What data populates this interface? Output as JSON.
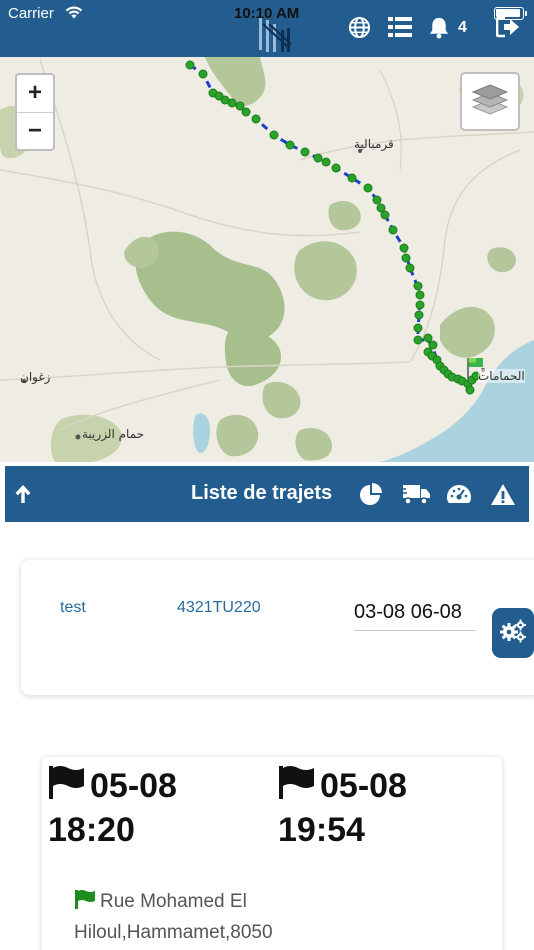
{
  "status_bar": {
    "carrier": "Carrier",
    "time": "10:10 AM"
  },
  "header": {
    "notification_count": "4",
    "icons": [
      "globe-icon",
      "list-icon",
      "bell-icon",
      "logout-icon"
    ]
  },
  "map": {
    "zoom_in": "+",
    "zoom_out": "−",
    "labels": {
      "grombalia": "قرمبالية",
      "zaghouan": "زغوان",
      "hammam_zriba": "حمام الزريبة",
      "hammamet": "الحمامات"
    },
    "route_color": "#1a3fd1",
    "point_color": "#29a329"
  },
  "trip_bar": {
    "title": "Liste de trajets",
    "icons": [
      "arrow-up-icon",
      "pie-chart-icon",
      "truck-icon",
      "speedometer-icon",
      "warning-icon"
    ]
  },
  "filter": {
    "name": "test",
    "plate": "4321TU220",
    "date": "03-08 06-08"
  },
  "trip": {
    "start_date": "05-08",
    "start_time": "18:20",
    "end_date": "05-08",
    "end_time": "19:54",
    "start_address": "Rue Mohamed El Hiloul,Hammamet,8050"
  },
  "colors": {
    "primary": "#235d8f",
    "flag_green": "#1e8c1e"
  }
}
